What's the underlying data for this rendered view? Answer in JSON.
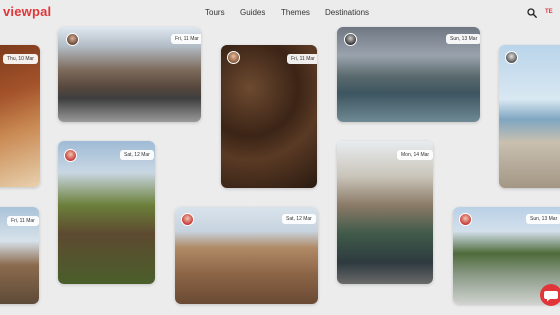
{
  "brand": {
    "name": "viewpal",
    "accent": "#e0363a"
  },
  "nav": {
    "items": [
      "Tours",
      "Guides",
      "Themes",
      "Destinations"
    ]
  },
  "lang": "TE",
  "icons": {
    "search": "search-icon",
    "chat": "chat-bubble-icon"
  },
  "cards": [
    {
      "date": "Thu, 10 Mar"
    },
    {
      "date": "Fri, 11 Mar"
    },
    {
      "date": "Fri, 11 Mar"
    },
    {
      "date": "Sun, 13 Mar"
    },
    {
      "date": "Sat, 12 Mar"
    },
    {
      "date": "Sat, 12 Mar"
    },
    {
      "date": "Mon, 14 Mar"
    },
    {
      "date": "Fri, 11 Mar"
    },
    {
      "date": "Sun, 13 Mar"
    }
  ]
}
